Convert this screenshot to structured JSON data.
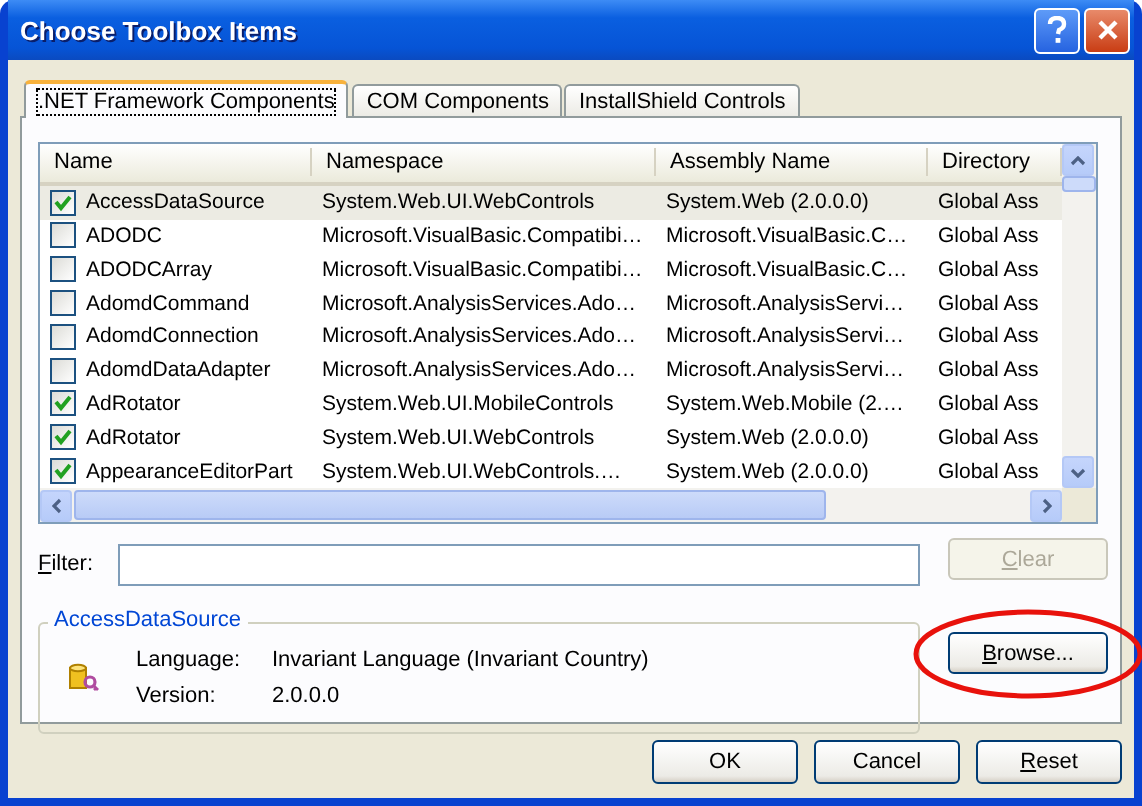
{
  "window": {
    "title": "Choose Toolbox Items"
  },
  "tabs": [
    {
      "label": ".NET Framework Components",
      "selected": true
    },
    {
      "label": "COM Components",
      "selected": false
    },
    {
      "label": "InstallShield Controls",
      "selected": false
    }
  ],
  "table": {
    "columns": [
      "Name",
      "Namespace",
      "Assembly Name",
      "Directory"
    ],
    "rows": [
      {
        "checked": true,
        "selected": true,
        "cells": [
          "AccessDataSource",
          "System.Web.UI.WebControls",
          "System.Web (2.0.0.0)",
          "Global Ass"
        ]
      },
      {
        "checked": false,
        "selected": false,
        "cells": [
          "ADODC",
          "Microsoft.VisualBasic.Compatibi…",
          "Microsoft.VisualBasic.C…",
          "Global Ass"
        ]
      },
      {
        "checked": false,
        "selected": false,
        "cells": [
          "ADODCArray",
          "Microsoft.VisualBasic.Compatibi…",
          "Microsoft.VisualBasic.C…",
          "Global Ass"
        ]
      },
      {
        "checked": false,
        "selected": false,
        "cells": [
          "AdomdCommand",
          "Microsoft.AnalysisServices.Ado…",
          "Microsoft.AnalysisServi…",
          "Global Ass"
        ]
      },
      {
        "checked": false,
        "selected": false,
        "cells": [
          "AdomdConnection",
          "Microsoft.AnalysisServices.Ado…",
          "Microsoft.AnalysisServi…",
          "Global Ass"
        ]
      },
      {
        "checked": false,
        "selected": false,
        "cells": [
          "AdomdDataAdapter",
          "Microsoft.AnalysisServices.Ado…",
          "Microsoft.AnalysisServi…",
          "Global Ass"
        ]
      },
      {
        "checked": true,
        "selected": false,
        "cells": [
          "AdRotator",
          "System.Web.UI.MobileControls",
          "System.Web.Mobile (2.…",
          "Global Ass"
        ]
      },
      {
        "checked": true,
        "selected": false,
        "cells": [
          "AdRotator",
          "System.Web.UI.WebControls",
          "System.Web (2.0.0.0)",
          "Global Ass"
        ]
      },
      {
        "checked": true,
        "selected": false,
        "cells": [
          "AppearanceEditorPart",
          "System.Web.UI.WebControls.…",
          "System.Web (2.0.0.0)",
          "Global Ass"
        ]
      }
    ]
  },
  "filter": {
    "label": "Filter:",
    "access_key": true
  },
  "clear_button": {
    "label": "Clear",
    "disabled": true,
    "access_key": true
  },
  "details": {
    "title": "AccessDataSource",
    "fields": [
      {
        "label": "Language:",
        "value": "Invariant Language (Invariant Country)"
      },
      {
        "label": "Version:",
        "value": "2.0.0.0"
      }
    ]
  },
  "browse_button": {
    "label": "Browse...",
    "access_key": true,
    "highlighted": true
  },
  "buttons": [
    {
      "label": "OK",
      "access_key": false
    },
    {
      "label": "Cancel",
      "access_key": false
    },
    {
      "label": "Reset",
      "access_key": true
    }
  ]
}
